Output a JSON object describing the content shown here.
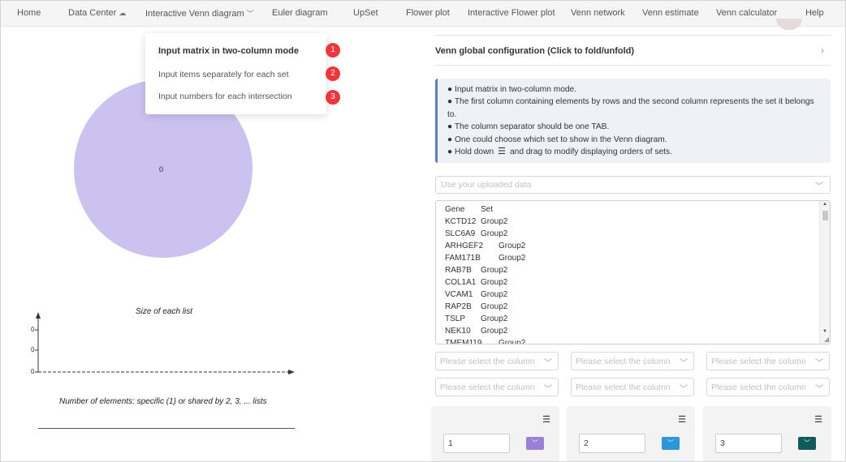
{
  "nav": {
    "items": [
      {
        "label": "Home"
      },
      {
        "label": "Data Center",
        "icon": "cloud-icon"
      },
      {
        "label": "Interactive Venn diagram",
        "icon": "chevron-down-icon"
      },
      {
        "label": "Euler diagram"
      },
      {
        "label": "UpSet"
      },
      {
        "label": "Flower plot"
      },
      {
        "label": "Interactive Flower plot"
      },
      {
        "label": "Venn network"
      },
      {
        "label": "Venn estimate"
      },
      {
        "label": "Venn calculator"
      },
      {
        "label": "Help"
      }
    ]
  },
  "dropdown": {
    "items": [
      {
        "label": "Input matrix in two-column mode",
        "badge": "1"
      },
      {
        "label": "Input items separately for each set",
        "badge": "2"
      },
      {
        "label": "Input numbers for each intersection",
        "badge": "3"
      }
    ]
  },
  "venn": {
    "region_value": "0",
    "color": "#cbc2ef"
  },
  "chart_data": {
    "type": "bar",
    "title": "Size of each list",
    "xlabel": "Number of elements: specific (1) or shared by 2, 3, ... lists",
    "y_ticks": [
      "0",
      "0",
      "0"
    ],
    "categories": [],
    "values": []
  },
  "config": {
    "title": "Venn global configuration (Click to fold/unfold)"
  },
  "info": {
    "lines": [
      "Input matrix in two-column mode.",
      "The first column containing elements by rows and the second column represents the set it belongs to.",
      "The column separator should be one TAB.",
      "One could choose which set to show in the Venn diagram.",
      "Hold down",
      "and drag to modify displaying orders of sets."
    ]
  },
  "data_source": {
    "placeholder": "Use your uploaded data"
  },
  "textarea": {
    "rows": [
      [
        "Gene",
        "Set"
      ],
      [
        "KCTD12",
        "Group2"
      ],
      [
        "SLC6A9",
        "Group2"
      ],
      [
        "ARHGEF2",
        "Group2"
      ],
      [
        "FAM171B",
        "Group2"
      ],
      [
        "RAB7B",
        "Group2"
      ],
      [
        "COL1A1",
        "Group2"
      ],
      [
        "VCAM1",
        "Group2"
      ],
      [
        "RAP2B",
        "Group2"
      ],
      [
        "TSLP",
        "Group2"
      ],
      [
        "NEK10",
        "Group2"
      ],
      [
        "TMEM119",
        "Group2"
      ]
    ]
  },
  "column_selects": {
    "placeholder": "Please select the column"
  },
  "sets": [
    {
      "name": "1",
      "color": "#9b7fd9"
    },
    {
      "name": "2",
      "color": "#2b97d8"
    },
    {
      "name": "3",
      "color": "#0f5d5b"
    }
  ]
}
